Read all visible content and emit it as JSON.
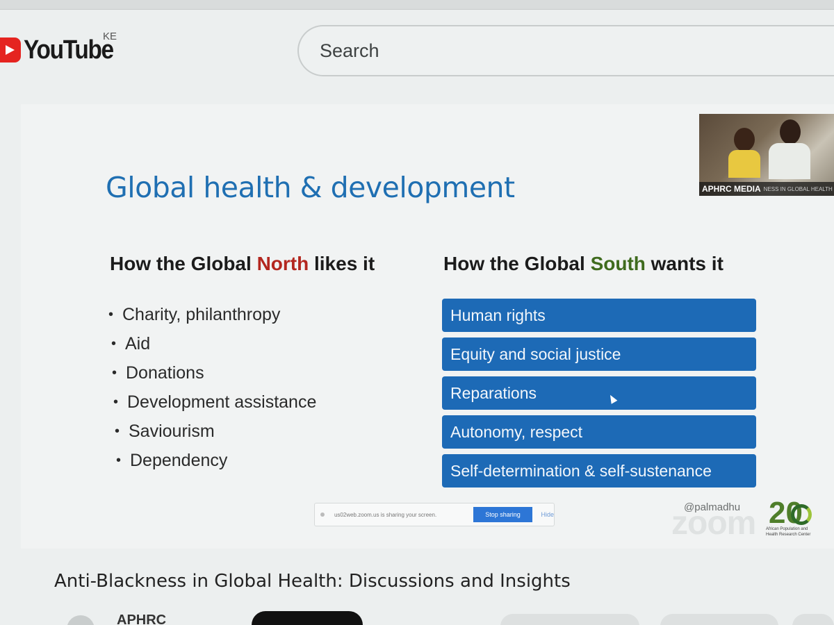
{
  "header": {
    "logo_text": "YouTube",
    "country_code": "KE",
    "search": {
      "placeholder": "Search"
    }
  },
  "slide": {
    "title": "Global health & development",
    "north": {
      "heading_pre": "How the Global ",
      "heading_accent": "North",
      "heading_post": " likes it",
      "items": [
        "Charity, philanthropy",
        "Aid",
        "Donations",
        "Development assistance",
        "Saviourism",
        "Dependency"
      ]
    },
    "south": {
      "heading_pre": "How the Global ",
      "heading_accent": "South",
      "heading_post": " wants it",
      "items": [
        "Human rights",
        "Equity and social justice",
        "Reparations",
        "Autonomy, respect",
        "Self-determination & self-sustenance"
      ]
    },
    "colors": {
      "title": "#1f6fb2",
      "north_accent": "#b3271f",
      "south_accent": "#3f6b1e",
      "box": "#1d6ab6"
    }
  },
  "webcam": {
    "caption": "APHRC MEDIA",
    "ticker": "NESS IN GLOBAL HEALTH"
  },
  "zoom_share": {
    "text": "us02web.zoom.us is sharing your screen.",
    "stop_label": "Stop sharing",
    "hide_label": "Hide"
  },
  "branding": {
    "handle": "@palmadhu",
    "watermark": "zoom",
    "anniversary": "20",
    "org_line": "African Population and Health Research Center"
  },
  "video": {
    "title": "Anti-Blackness in Global Health: Discussions and Insights",
    "channel": "APHRC"
  }
}
